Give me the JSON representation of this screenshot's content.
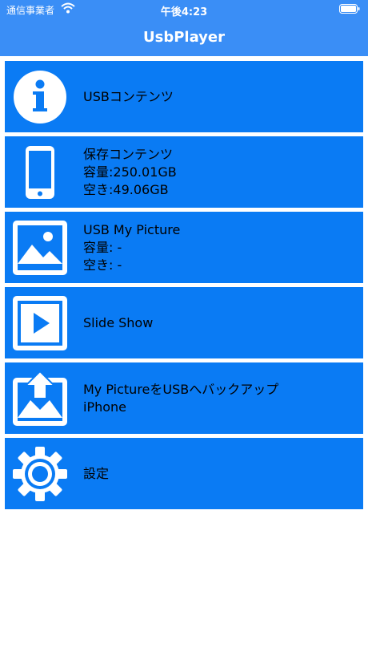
{
  "status_bar": {
    "carrier": "通信事業者",
    "time": "午後4:23"
  },
  "header": {
    "title": "UsbPlayer"
  },
  "colors": {
    "header": "#3a8ef6",
    "row": "#0a7bf4",
    "icon": "#ffffff",
    "text": "#000000"
  },
  "menu": [
    {
      "icon": "info-icon",
      "lines": [
        "USBコンテンツ"
      ]
    },
    {
      "icon": "phone-icon",
      "lines": [
        "保存コンテンツ",
        "容量:250.01GB",
        "空き:49.06GB"
      ]
    },
    {
      "icon": "picture-icon",
      "lines": [
        "USB My Picture",
        "容量: -",
        "空き: -"
      ]
    },
    {
      "icon": "play-icon",
      "lines": [
        "Slide Show"
      ]
    },
    {
      "icon": "backup-icon",
      "lines": [
        "My PictureをUSBへバックアップ",
        "iPhone"
      ]
    },
    {
      "icon": "gear-icon",
      "lines": [
        "設定"
      ]
    }
  ]
}
